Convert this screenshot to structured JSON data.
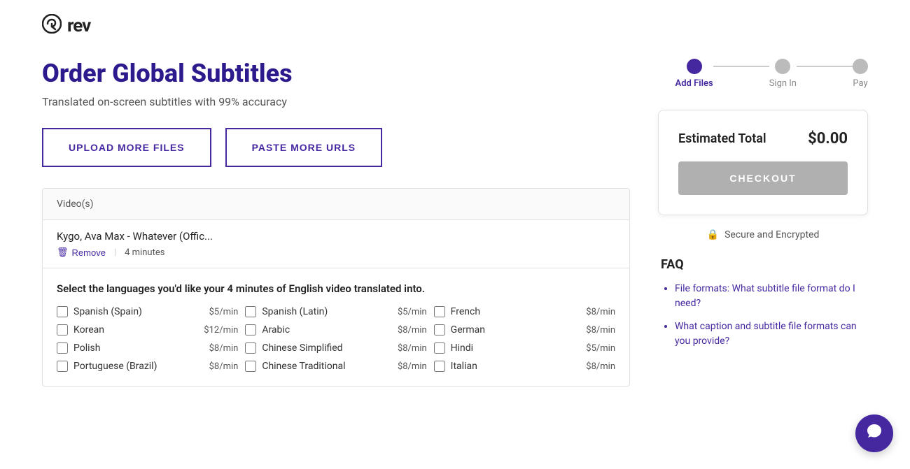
{
  "logo": {
    "icon": "@",
    "text": "rev"
  },
  "steps": [
    {
      "label": "Add Files",
      "state": "active"
    },
    {
      "label": "Sign In",
      "state": "inactive"
    },
    {
      "label": "Pay",
      "state": "inactive"
    }
  ],
  "page": {
    "title": "Order Global Subtitles",
    "subtitle": "Translated on-screen subtitles with 99% accuracy"
  },
  "buttons": {
    "upload": "UPLOAD MORE FILES",
    "paste": "PASTE MORE URLS"
  },
  "table": {
    "header": "Video(s)",
    "video_title": "Kygo, Ava Max - Whatever (Offic...",
    "remove_label": "Remove",
    "duration": "4 minutes",
    "lang_prompt": "Select the languages you'd like your 4 minutes of English video translated into.",
    "languages": [
      {
        "name": "Spanish (Spain)",
        "price": "$5/min"
      },
      {
        "name": "Spanish (Latin)",
        "price": "$5/min"
      },
      {
        "name": "French",
        "price": "$8/min"
      },
      {
        "name": "Korean",
        "price": "$12/min"
      },
      {
        "name": "Arabic",
        "price": "$8/min"
      },
      {
        "name": "German",
        "price": "$8/min"
      },
      {
        "name": "Polish",
        "price": "$8/min"
      },
      {
        "name": "Chinese Simplified",
        "price": "$8/min"
      },
      {
        "name": "Hindi",
        "price": "$5/min"
      },
      {
        "name": "Portuguese (Brazil)",
        "price": "$8/min"
      },
      {
        "name": "Chinese Traditional",
        "price": "$8/min"
      },
      {
        "name": "Italian",
        "price": "$8/min"
      }
    ]
  },
  "summary": {
    "estimated_label": "Estimated Total",
    "amount": "$0.00",
    "checkout_label": "CHECKOUT"
  },
  "secure": {
    "icon": "🔒",
    "text": "Secure and Encrypted"
  },
  "faq": {
    "title": "FAQ",
    "items": [
      "File formats: What subtitle file format do I need?",
      "What caption and subtitle file formats can you provide?"
    ]
  },
  "chat": {
    "icon": "💬"
  }
}
